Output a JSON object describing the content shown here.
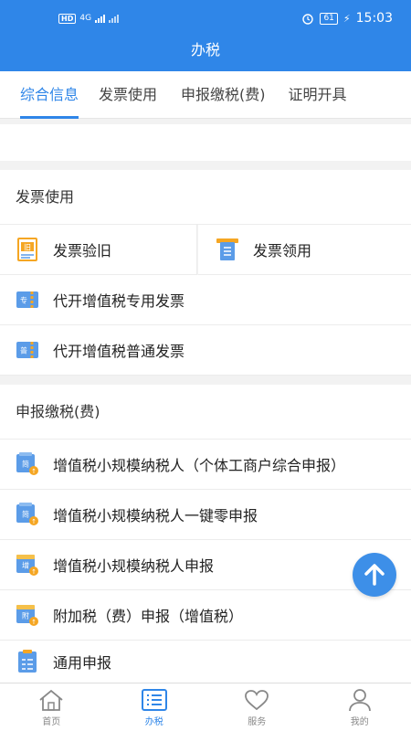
{
  "status_bar": {
    "network": "HD",
    "signal": "4G",
    "battery": "61",
    "time": "15:03"
  },
  "header": {
    "title": "办税"
  },
  "tabs": [
    {
      "label": "综合信息",
      "active": true
    },
    {
      "label": "发票使用",
      "active": false
    },
    {
      "label": "申报缴税(费)",
      "active": false
    },
    {
      "label": "证明开具",
      "active": false
    }
  ],
  "invoice_section": {
    "title": "发票使用",
    "items": [
      {
        "label": "发票验旧",
        "icon": "invoice-check-icon"
      },
      {
        "label": "发票领用",
        "icon": "invoice-receive-icon"
      },
      {
        "label": "代开增值税专用发票",
        "icon": "special-invoice-ticket-icon",
        "badge": "专"
      },
      {
        "label": "代开增值税普通发票",
        "icon": "general-invoice-ticket-icon",
        "badge": "普"
      }
    ]
  },
  "tax_section": {
    "title": "申报缴税(费)",
    "items": [
      {
        "label": "增值税小规模纳税人（个体工商户综合申报）",
        "badge": "简"
      },
      {
        "label": "增值税小规模纳税人一键零申报",
        "badge": "简"
      },
      {
        "label": "增值税小规模纳税人申报",
        "badge": "增"
      },
      {
        "label": "附加税（费）申报（增值税）",
        "badge": "附"
      },
      {
        "label": "通用申报",
        "badge": ""
      }
    ]
  },
  "bottom_nav": [
    {
      "label": "首页",
      "icon": "home-icon",
      "active": false
    },
    {
      "label": "办税",
      "icon": "list-icon",
      "active": true
    },
    {
      "label": "服务",
      "icon": "heart-icon",
      "active": false
    },
    {
      "label": "我的",
      "icon": "person-icon",
      "active": false
    }
  ],
  "colors": {
    "primary": "#2f86e8",
    "badge_orange": "#f5a623"
  }
}
